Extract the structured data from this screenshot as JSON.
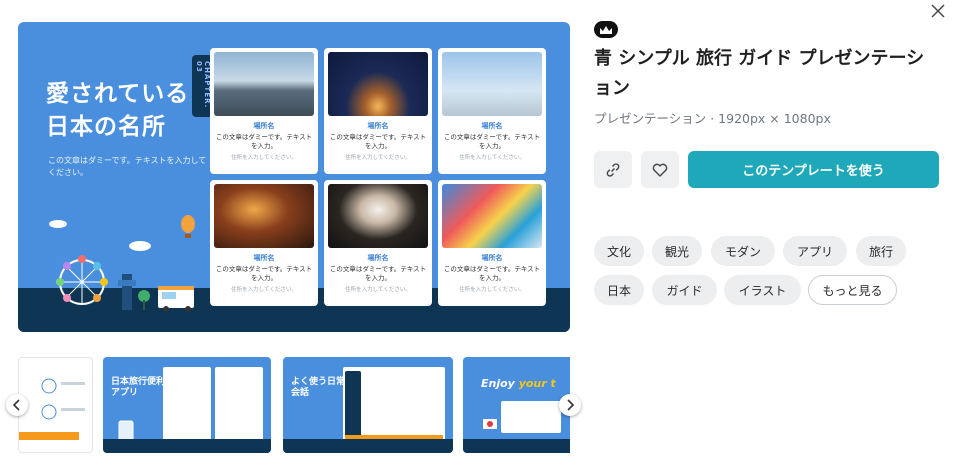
{
  "template": {
    "title": "青 シンプル 旅行 ガイド プレゼンテーション",
    "meta": "プレゼンテーション · 1920px × 1080px",
    "use_button": "このテンプレートを使う"
  },
  "slide": {
    "heading": "愛されている日本の名所",
    "body": "この文章はダミーです。テキストを入力してください。",
    "chapter": "CHAPTER. 03",
    "cards": [
      {
        "title": "場所名",
        "text": "この文章はダミーです。テキストを入力。",
        "sub": "住所を入力してください。"
      },
      {
        "title": "場所名",
        "text": "この文章はダミーです。テキストを入力。",
        "sub": "住所を入力してください。"
      },
      {
        "title": "場所名",
        "text": "この文章はダミーです。テキストを入力。",
        "sub": "住所を入力してください。"
      },
      {
        "title": "場所名",
        "text": "この文章はダミーです。テキストを入力。",
        "sub": "住所を入力してください。"
      },
      {
        "title": "場所名",
        "text": "この文章はダミーです。テキストを入力。",
        "sub": "住所を入力してください。"
      },
      {
        "title": "場所名",
        "text": "この文章はダミーです。テキストを入力。",
        "sub": "住所を入力してください。"
      }
    ]
  },
  "thumbnails": {
    "t2": "日本旅行便利アプリ",
    "t3": "よく使う日常会話",
    "t4_prefix": "Enjoy ",
    "t4_accent": "your t"
  },
  "tags": [
    "文化",
    "観光",
    "モダン",
    "アプリ",
    "旅行",
    "日本",
    "ガイド",
    "イラスト",
    "もっと見る"
  ],
  "colors": {
    "slide_bg": "#4a8fde",
    "slide_ground": "#0f3554",
    "accent": "#1fa8ba",
    "card_title": "#3b82d6"
  }
}
